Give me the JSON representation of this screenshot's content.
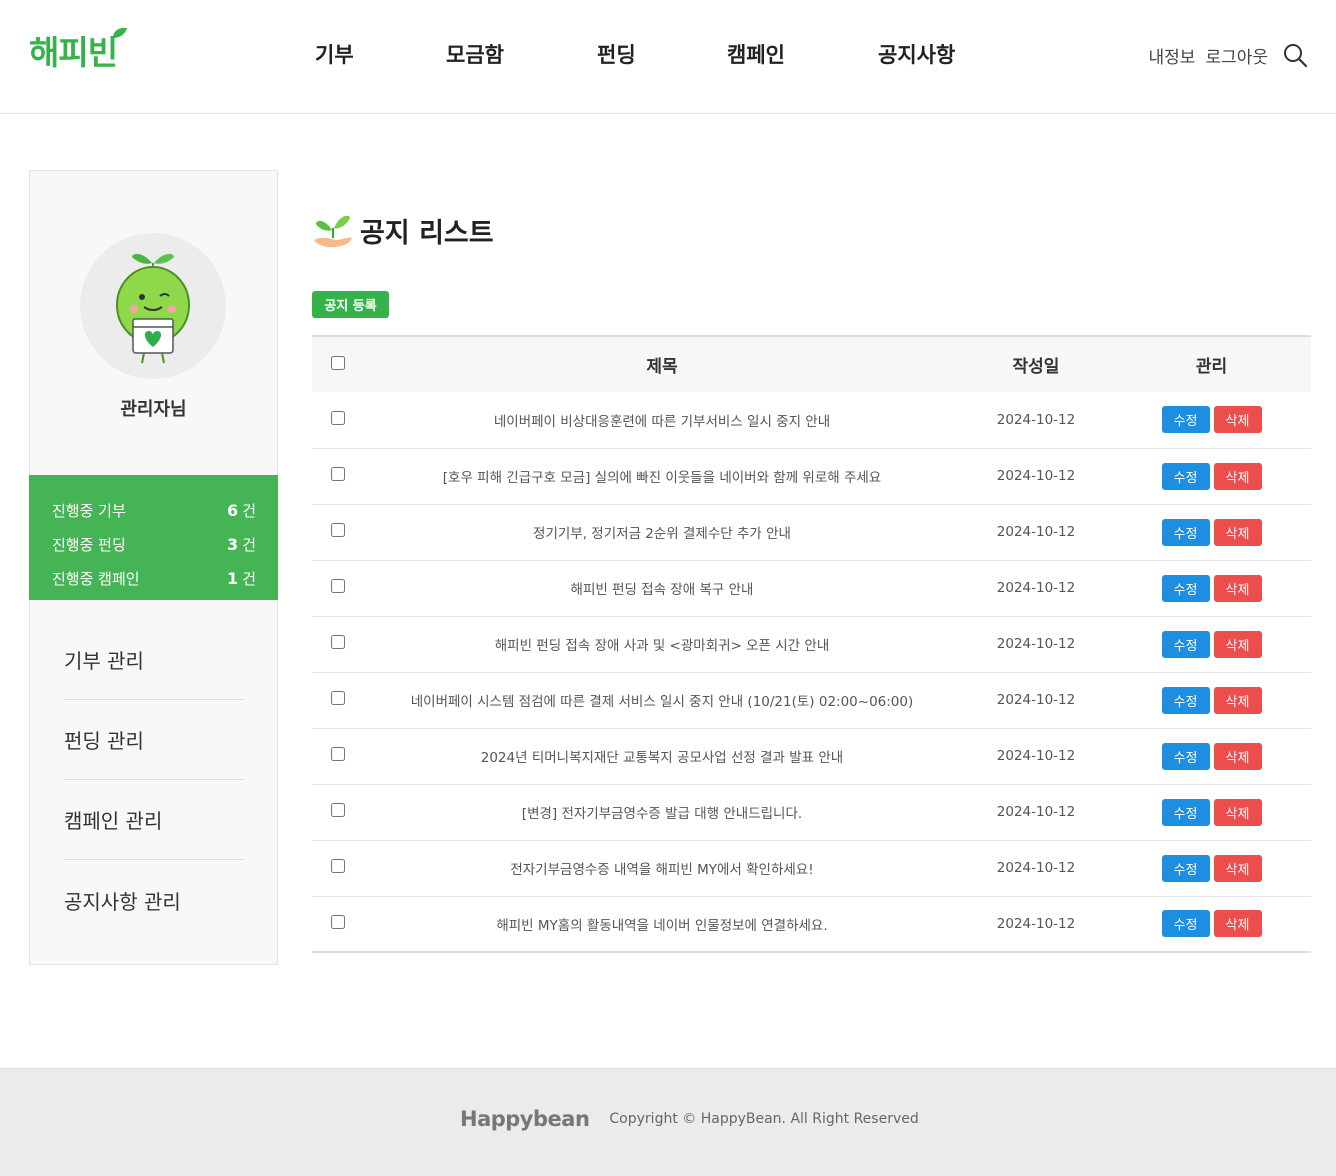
{
  "brand": {
    "logo_text": "해피빈",
    "color": "#36b24a"
  },
  "nav": {
    "items": [
      "기부",
      "모금함",
      "펀딩",
      "캠페인",
      "공지사항"
    ]
  },
  "util": {
    "myinfo": "내정보",
    "logout": "로그아웃",
    "search_icon": "search-icon"
  },
  "sidebar": {
    "admin_name": "관리자님",
    "stats": [
      {
        "label": "진행중 기부",
        "count": "6",
        "unit": "건"
      },
      {
        "label": "진행중 펀딩",
        "count": "3",
        "unit": "건"
      },
      {
        "label": "진행중 캠페인",
        "count": "1",
        "unit": "건"
      }
    ],
    "menu": [
      "기부 관리",
      "펀딩 관리",
      "캠페인 관리",
      "공지사항 관리"
    ]
  },
  "main": {
    "title": "공지 리스트",
    "register_button": "공지 등록",
    "table": {
      "headers": {
        "title": "제목",
        "date": "작성일",
        "manage": "관리"
      },
      "edit_label": "수정",
      "delete_label": "삭제",
      "rows": [
        {
          "title": "네이버페이 비상대응훈련에 따른 기부서비스 일시 중지 안내",
          "date": "2024-10-12"
        },
        {
          "title": "[호우 피해 긴급구호 모금] 실의에 빠진 이웃들을 네이버와 함께 위로해 주세요",
          "date": "2024-10-12"
        },
        {
          "title": "정기기부, 정기저금 2순위 결제수단 추가 안내",
          "date": "2024-10-12"
        },
        {
          "title": "해피빈 펀딩 접속 장애 복구 안내",
          "date": "2024-10-12"
        },
        {
          "title": "해피빈 펀딩 접속 장애 사과 및 <광마회귀> 오픈 시간 안내",
          "date": "2024-10-12"
        },
        {
          "title": "네이버페이 시스템 점검에 따른 결제 서비스 일시 중지 안내 (10/21(토) 02:00~06:00)",
          "date": "2024-10-12"
        },
        {
          "title": "2024년 티머니복지재단 교통복지 공모사업 선정 결과 발표 안내",
          "date": "2024-10-12"
        },
        {
          "title": "[변경] 전자기부금영수증 발급 대행 안내드립니다.",
          "date": "2024-10-12"
        },
        {
          "title": "전자기부금영수증 내역을 해피빈 MY에서 확인하세요!",
          "date": "2024-10-12"
        },
        {
          "title": "해피빈 MY홈의 활동내역을 네이버 인물정보에 연결하세요.",
          "date": "2024-10-12"
        }
      ]
    }
  },
  "footer": {
    "logo": "Happybean",
    "copyright": "Copyright © HappyBean. All Right Reserved"
  },
  "colors": {
    "accent": "#44b454",
    "edit": "#1c8fe0",
    "delete": "#ec4d4d"
  }
}
